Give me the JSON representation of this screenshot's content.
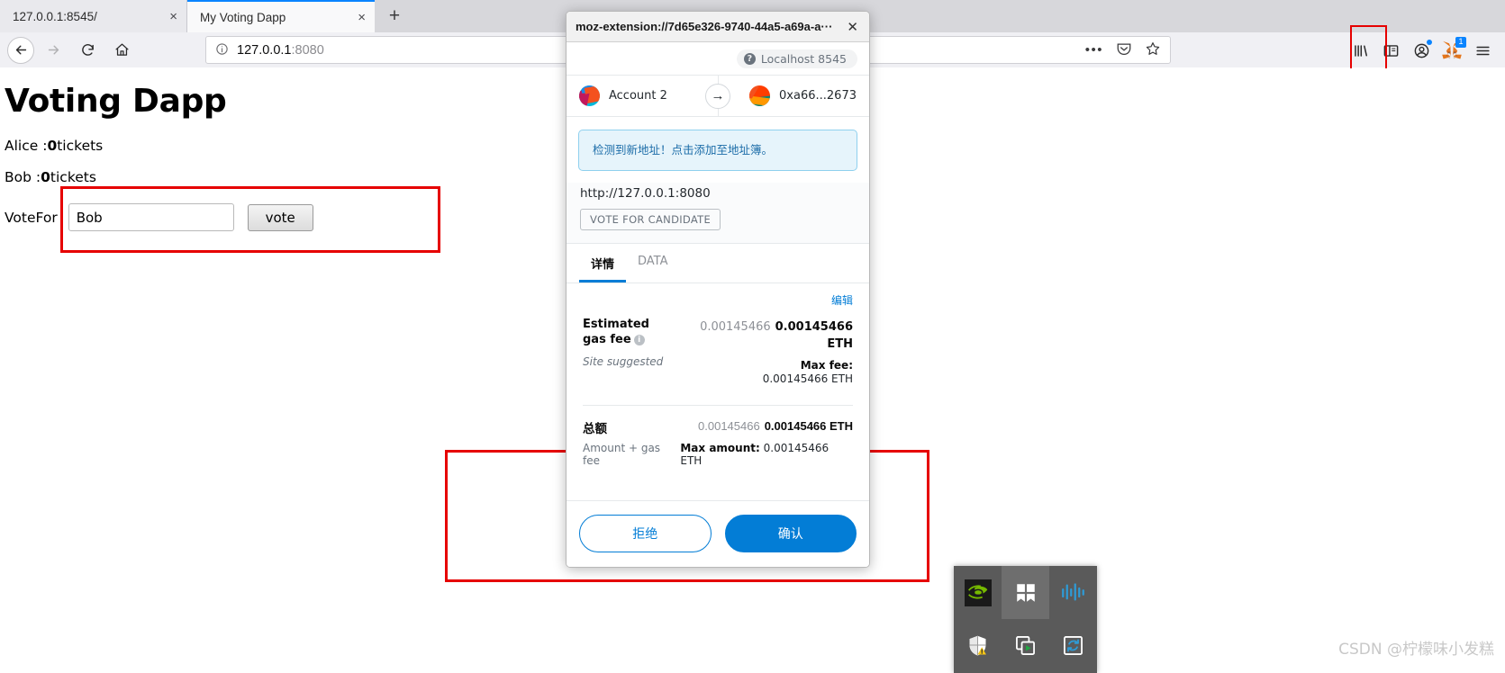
{
  "browser": {
    "tabs": [
      {
        "title": "127.0.0.1:8545/",
        "active": false,
        "close_label": "×"
      },
      {
        "title": "My Voting Dapp",
        "active": true,
        "close_label": "×"
      }
    ],
    "new_tab_label": "+",
    "nav": {
      "back_icon": "←",
      "forward_icon": "→",
      "reload_icon": "⟳",
      "home_icon": "⌂"
    },
    "url": {
      "info_icon": "ⓘ",
      "host": "127.0.0.1",
      "rest": ":8080",
      "more_icon": "•••",
      "pocket_icon": "pocket",
      "bookmark_icon": "☆"
    },
    "toolbar": {
      "library_icon": "library",
      "sidebar_icon": "sidebar",
      "account_icon": "account",
      "metamask_icon": "metamask-fox",
      "metamask_badge": "1",
      "menu_icon": "☰"
    }
  },
  "page": {
    "title": "Voting Dapp",
    "tallies": [
      {
        "name": "Alice",
        "sep": " :",
        "count": "0",
        "unit": "tickets"
      },
      {
        "name": "Bob",
        "sep": " :",
        "count": "0",
        "unit": "tickets"
      }
    ],
    "form": {
      "label": "VoteFor",
      "input_value": "Bob",
      "input_placeholder": "",
      "button_label": "vote"
    }
  },
  "metamask": {
    "window_title": "moz-extension://7d65e326-9740-44a5-a69a-a···",
    "close_label": "✕",
    "network": {
      "icon": "?",
      "label": "Localhost 8545"
    },
    "from": {
      "name": "Account 2",
      "blockie": "from-blockie"
    },
    "transfer_arrow": "→",
    "to": {
      "name": "0xa66...2673",
      "blockie": "to-blockie"
    },
    "alert": "检测到新地址！点击添加至地址簿。",
    "origin_url": "http://127.0.0.1:8080",
    "method_label": "VOTE FOR CANDIDATE",
    "tabs": [
      {
        "label": "详情",
        "active": true
      },
      {
        "label": "DATA",
        "active": false
      }
    ],
    "edit_label": "编辑",
    "gas": {
      "label": "Estimated gas fee",
      "info_icon": "i",
      "alt_value": "0.00145466",
      "main_value": "0.00145466 ETH",
      "suggested": "Site suggested",
      "max_fee_key": "Max fee:",
      "max_fee_value": "0.00145466 ETH"
    },
    "total": {
      "label": "总额",
      "alt_value": "0.00145466",
      "main_value": "0.00145466 ETH",
      "sub_left": "Amount + gas fee",
      "sub_right_key": "Max amount:",
      "sub_right_value": "0.00145466 ETH"
    },
    "reject_label": "拒绝",
    "confirm_label": "确认"
  },
  "tray": {
    "items": [
      {
        "name": "nvidia-icon",
        "highlight": false
      },
      {
        "name": "windows-panels-icon",
        "highlight": true
      },
      {
        "name": "wave-icon",
        "highlight": false
      },
      {
        "name": "shield-warning-icon",
        "highlight": false
      },
      {
        "name": "copy-play-icon",
        "highlight": false
      },
      {
        "name": "refresh-box-icon",
        "highlight": false
      }
    ]
  },
  "watermark": "CSDN @柠檬味小发糕",
  "colors": {
    "accent_blue": "#037dd6",
    "firefox_tab_blue": "#0a84ff",
    "highlight_red": "#e60000",
    "alert_blue": "#1b6ca8"
  }
}
